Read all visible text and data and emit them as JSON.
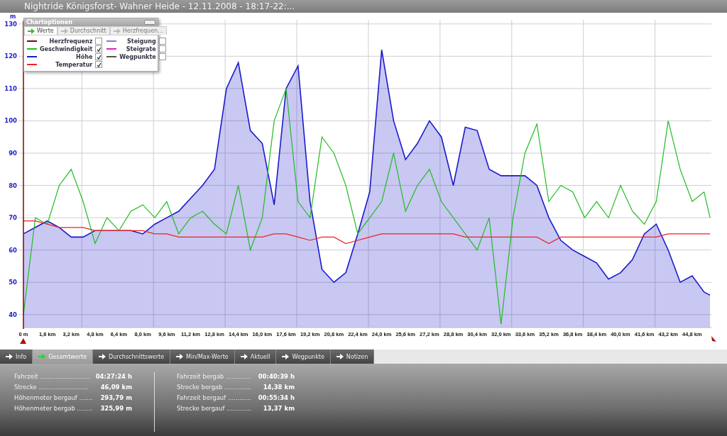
{
  "window": {
    "title": "Nightride Königsforst- Wahner Heide - 12.11.2008 - 18:17-22:..."
  },
  "chart_options": {
    "title": "Chartoptionen",
    "tabs": [
      {
        "label": "Werte",
        "selected": true
      },
      {
        "label": "Durchschnitt",
        "selected": false
      },
      {
        "label": "Herzfrequen...",
        "selected": false
      }
    ],
    "left_items": [
      {
        "label": "Herzfrequenz",
        "color": "#8b0000",
        "checked": false
      },
      {
        "checked": true
      },
      {
        "checked": true
      },
      {
        "checked": true
      }
    ],
    "right_items": [
      {
        "label": "Steigung",
        "color": "#9966ff",
        "checked": false
      },
      {
        "label": "Steigrate",
        "color": "#e020c0",
        "checked": false
      },
      {
        "label": "Wegpunkte",
        "color": "#555544",
        "checked": false
      }
    ]
  },
  "chart": {
    "chart_data": {
      "type": "area",
      "grid": true,
      "ylabel": "m",
      "xlim": [
        0,
        46.09
      ],
      "ylim": [
        36,
        131
      ],
      "yticks": [
        40,
        50,
        60,
        70,
        80,
        90,
        100,
        110,
        120,
        130
      ],
      "xticks": [
        {
          "value": 0,
          "label": "0 m"
        },
        {
          "value": 1.6,
          "label": "1,6 km"
        },
        {
          "value": 3.2,
          "label": "3,2 km"
        },
        {
          "value": 4.8,
          "label": "4,8 km"
        },
        {
          "value": 6.4,
          "label": "6,4 km"
        },
        {
          "value": 8.0,
          "label": "8,0 km"
        },
        {
          "value": 9.6,
          "label": "9,6 km"
        },
        {
          "value": 11.2,
          "label": "11,2 km"
        },
        {
          "value": 12.8,
          "label": "12,8 km"
        },
        {
          "value": 14.4,
          "label": "14,4 km"
        },
        {
          "value": 16.0,
          "label": "16,0 km"
        },
        {
          "value": 17.6,
          "label": "17,6 km"
        },
        {
          "value": 19.2,
          "label": "19,2 km"
        },
        {
          "value": 20.8,
          "label": "20,8 km"
        },
        {
          "value": 22.4,
          "label": "22,4 km"
        },
        {
          "value": 24.0,
          "label": "24,0 km"
        },
        {
          "value": 25.6,
          "label": "25,6 km"
        },
        {
          "value": 27.2,
          "label": "27,2 km"
        },
        {
          "value": 28.8,
          "label": "28,8 km"
        },
        {
          "value": 30.4,
          "label": "30,4 km"
        },
        {
          "value": 32.0,
          "label": "32,0 km"
        },
        {
          "value": 33.6,
          "label": "33,6 km"
        },
        {
          "value": 35.2,
          "label": "35,2 km"
        },
        {
          "value": 36.8,
          "label": "36,8 km"
        },
        {
          "value": 38.4,
          "label": "38,4 km"
        },
        {
          "value": 40.0,
          "label": "40,0 km"
        },
        {
          "value": 41.6,
          "label": "41,6 km"
        },
        {
          "value": 43.2,
          "label": "43,2 km"
        },
        {
          "value": 44.8,
          "label": "44,8 km"
        }
      ],
      "x": [
        0,
        0.8,
        1.6,
        2.4,
        3.2,
        4.0,
        4.8,
        5.6,
        6.4,
        7.2,
        8.0,
        8.8,
        9.6,
        10.4,
        11.2,
        12.0,
        12.8,
        13.6,
        14.4,
        15.2,
        16.0,
        16.8,
        17.6,
        18.4,
        19.2,
        20.0,
        20.8,
        21.6,
        22.4,
        23.2,
        24.0,
        24.8,
        25.6,
        26.4,
        27.2,
        28.0,
        28.8,
        29.6,
        30.4,
        31.2,
        32.0,
        32.8,
        33.6,
        34.4,
        35.2,
        36.0,
        36.8,
        37.6,
        38.4,
        39.2,
        40.0,
        40.8,
        41.6,
        42.4,
        43.2,
        44.0,
        44.8,
        45.6,
        46.0
      ],
      "series": [
        {
          "name": "Höhe",
          "color": "#1a1acc",
          "values": [
            65,
            67,
            69,
            67,
            64,
            64,
            66,
            66,
            66,
            66,
            65,
            68,
            70,
            72,
            76,
            80,
            85,
            110,
            118,
            97,
            93,
            74,
            110,
            117,
            75,
            54,
            50,
            53,
            65,
            78,
            122,
            100,
            88,
            93,
            100,
            95,
            80,
            98,
            97,
            85,
            83,
            83,
            83,
            80,
            70,
            63,
            60,
            58,
            56,
            51,
            53,
            57,
            65,
            68,
            60,
            50,
            52,
            47,
            46
          ]
        }
      ]
    }
  },
  "overlay_chart": {
    "chart_data": {
      "type": "line",
      "xlim": [
        0,
        46.09
      ],
      "ylim": [
        36,
        131
      ],
      "x": [
        0,
        0.8,
        1.6,
        2.4,
        3.2,
        4.0,
        4.8,
        5.6,
        6.4,
        7.2,
        8.0,
        8.8,
        9.6,
        10.4,
        11.2,
        12.0,
        12.8,
        13.6,
        14.4,
        15.2,
        16.0,
        16.8,
        17.6,
        18.4,
        19.2,
        20.0,
        20.8,
        21.6,
        22.4,
        23.2,
        24.0,
        24.8,
        25.6,
        26.4,
        27.2,
        28.0,
        28.8,
        29.6,
        30.4,
        31.2,
        32.0,
        32.8,
        33.6,
        34.4,
        35.2,
        36.0,
        36.8,
        37.6,
        38.4,
        39.2,
        40.0,
        40.8,
        41.6,
        42.4,
        43.2,
        44.0,
        44.8,
        45.6,
        46.0
      ],
      "series": [
        {
          "name": "Geschwindigkeit",
          "color": "#22bb22",
          "values": [
            40,
            70,
            68,
            80,
            85,
            75,
            62,
            70,
            66,
            72,
            74,
            70,
            75,
            65,
            70,
            72,
            68,
            65,
            80,
            60,
            70,
            100,
            110,
            75,
            70,
            95,
            90,
            80,
            65,
            70,
            75,
            90,
            72,
            80,
            85,
            75,
            70,
            65,
            60,
            70,
            37,
            70,
            90,
            99,
            75,
            80,
            78,
            70,
            75,
            70,
            80,
            72,
            68,
            75,
            100,
            85,
            75,
            78,
            70
          ]
        },
        {
          "name": "Temperatur",
          "color": "#ee2222",
          "values": [
            69,
            69,
            68,
            67,
            67,
            67,
            66,
            66,
            66,
            66,
            66,
            65,
            65,
            64,
            64,
            64,
            64,
            64,
            64,
            64,
            64,
            65,
            65,
            64,
            63,
            64,
            64,
            62,
            63,
            64,
            65,
            65,
            65,
            65,
            65,
            65,
            65,
            64,
            64,
            64,
            64,
            64,
            64,
            64,
            62,
            64,
            64,
            64,
            64,
            64,
            64,
            64,
            64,
            64,
            65,
            65,
            65,
            65,
            65
          ]
        }
      ]
    }
  },
  "bottom_tabs": [
    {
      "label": "Info",
      "selected": false
    },
    {
      "label": "Gesamtwerte",
      "selected": true
    },
    {
      "label": "Durchschnittswerte",
      "selected": false
    },
    {
      "label": "Min/Max-Werte",
      "selected": false
    },
    {
      "label": "Aktuell",
      "selected": false
    },
    {
      "label": "Wegpunkte",
      "selected": false
    },
    {
      "label": "Notizen",
      "selected": false
    }
  ],
  "stats_left": [
    {
      "label": "Fahrzeit ..........................",
      "value": "04:27:24 h"
    },
    {
      "label": "Strecke ..........................",
      "value": "46,09 km"
    },
    {
      "label": "Höhenmeter bergauf .......",
      "value": "293,79 m"
    },
    {
      "label": "Höhenmeter bergab ........",
      "value": "325,99 m"
    }
  ],
  "stats_right": [
    {
      "label": "Fahrzeit bergab .............",
      "value": "00:40:39 h"
    },
    {
      "label": "Strecke bergab ..............",
      "value": "14,38 km"
    },
    {
      "label": "Fahrzeit bergauf ............",
      "value": "00:55:34 h"
    },
    {
      "label": "Strecke bergauf .............",
      "value": "13,37 km"
    }
  ]
}
